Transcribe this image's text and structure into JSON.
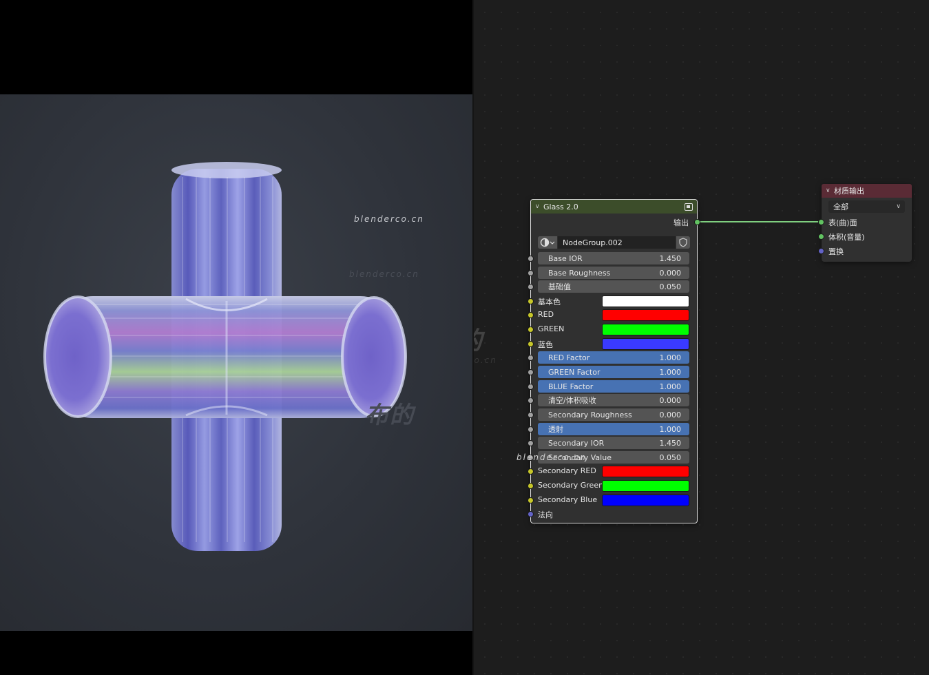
{
  "viewport": {
    "watermarks": [
      "blenderco.cn",
      "blenderco.cn",
      "布的",
      "blenderco.cn",
      "布的",
      "blenderco.cn"
    ],
    "colors": {
      "background": "#2f333b",
      "letterbox": "#000000"
    }
  },
  "glass_node": {
    "title": "Glass 2.0",
    "output_label": "输出",
    "node_group_name": "NodeGroup.002",
    "fields": [
      {
        "label": "Base IOR",
        "value": "1.450",
        "highlight": false,
        "socket": "grey"
      },
      {
        "label": "Base Roughness",
        "value": "0.000",
        "highlight": false,
        "socket": "grey"
      },
      {
        "label": "基础值",
        "value": "0.050",
        "highlight": false,
        "socket": "grey"
      }
    ],
    "colors_a": [
      {
        "label": "基本色",
        "color": "#ffffff"
      },
      {
        "label": "RED",
        "color": "#ff0000"
      },
      {
        "label": "GREEN",
        "color": "#00ff00"
      },
      {
        "label": "蓝色",
        "color": "#3a3aff"
      }
    ],
    "fields_b": [
      {
        "label": "RED Factor",
        "value": "1.000",
        "highlight": true
      },
      {
        "label": "GREEN Factor",
        "value": "1.000",
        "highlight": true
      },
      {
        "label": "BLUE Factor",
        "value": "1.000",
        "highlight": true
      },
      {
        "label": "清空/体积吸收",
        "value": "0.000",
        "highlight": false
      },
      {
        "label": "Secondary Roughness",
        "value": "0.000",
        "highlight": false
      },
      {
        "label": "透射",
        "value": "1.000",
        "highlight": true
      },
      {
        "label": "Secondary IOR",
        "value": "1.450",
        "highlight": false
      },
      {
        "label": "Secondary Value",
        "value": "0.050",
        "highlight": false
      }
    ],
    "colors_b": [
      {
        "label": "Secondary RED",
        "color": "#ff0000"
      },
      {
        "label": "Secondary Green",
        "color": "#00ff00"
      },
      {
        "label": "Secondary Blue",
        "color": "#0000ff"
      }
    ],
    "normal_label": "法向"
  },
  "material_output_node": {
    "title": "材质输出",
    "target": "全部",
    "inputs": [
      {
        "label": "表(曲)面",
        "socket": "green"
      },
      {
        "label": "体积(音量)",
        "socket": "green"
      },
      {
        "label": "置换",
        "socket": "purple"
      }
    ]
  }
}
